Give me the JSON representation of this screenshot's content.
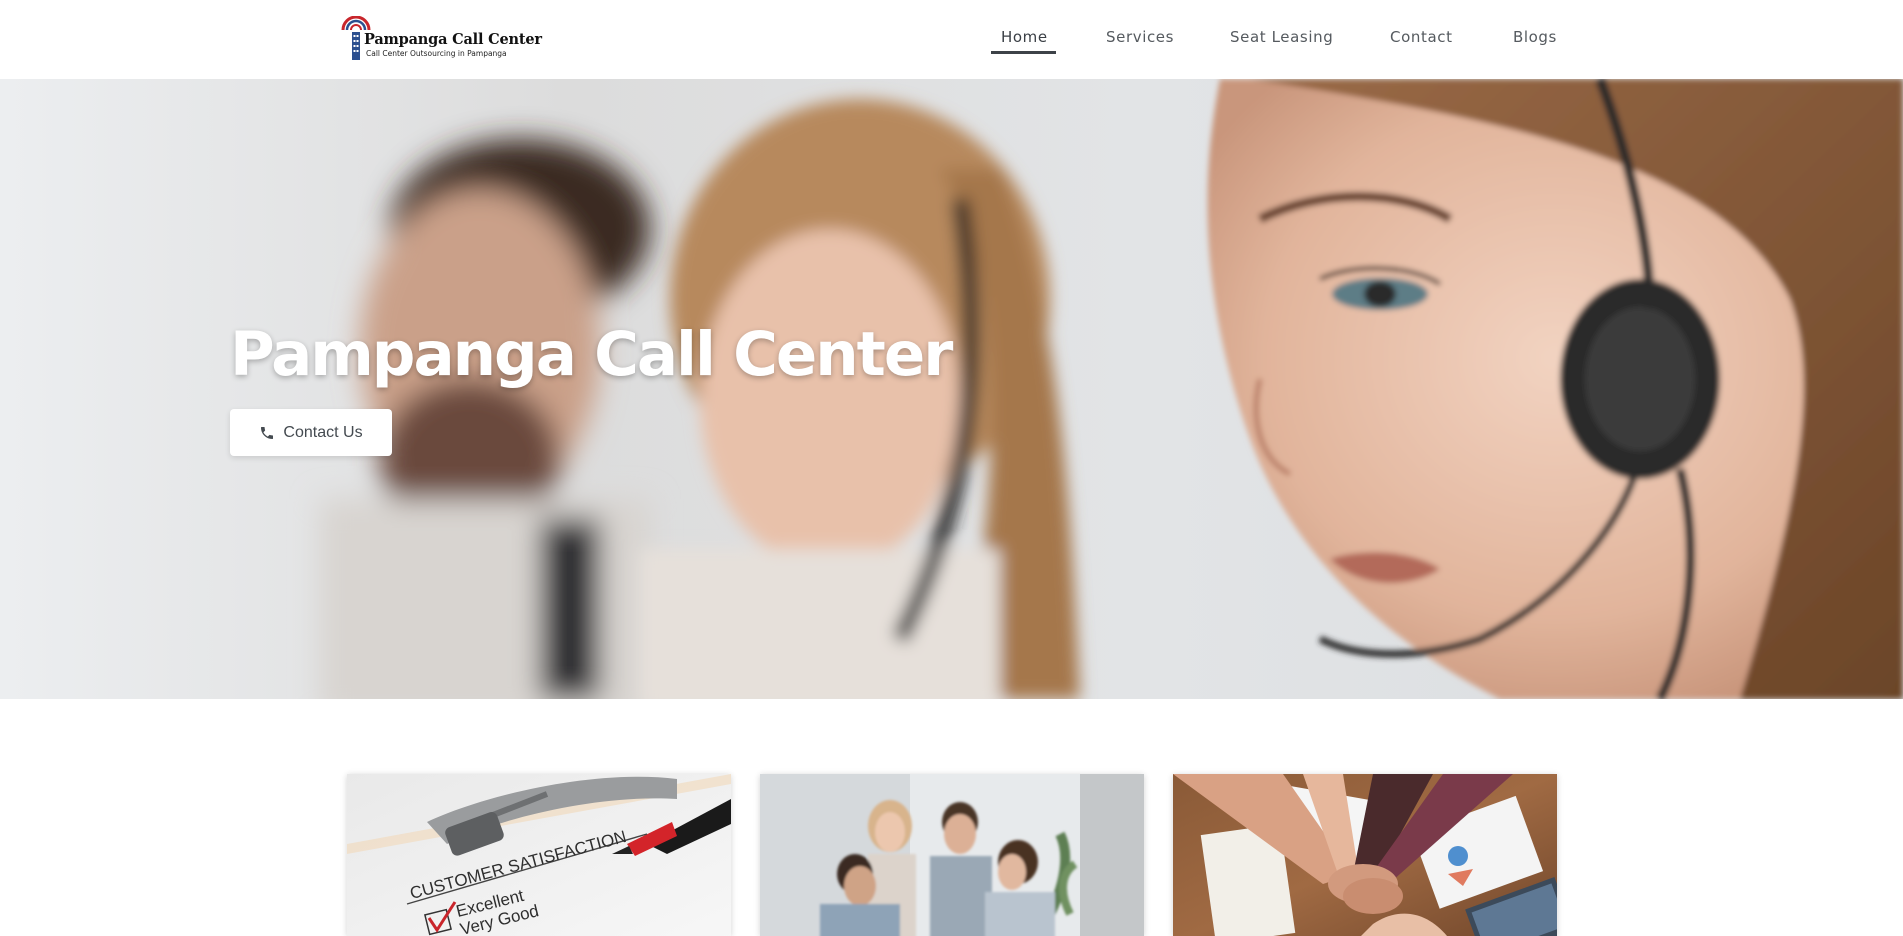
{
  "header": {
    "logo": {
      "title": "Pampanga Call Center",
      "tagline": "Call Center Outsourcing in Pampanga"
    },
    "nav": [
      {
        "label": "Home",
        "active": true
      },
      {
        "label": "Services",
        "active": false
      },
      {
        "label": "Seat Leasing",
        "active": false
      },
      {
        "label": "Contact",
        "active": false
      },
      {
        "label": "Blogs",
        "active": false
      }
    ]
  },
  "hero": {
    "title": "Pampanga Call Center",
    "cta_label": "Contact Us",
    "cta_icon": "phone-icon"
  },
  "cards": [
    {
      "image": "customer-satisfaction-survey-image",
      "image_text": {
        "heading": "CUSTOMER SATISFACTION",
        "option1": "Excellent",
        "option2": "Very Good"
      }
    },
    {
      "image": "team-meeting-image"
    },
    {
      "image": "team-hands-stack-image"
    }
  ],
  "colors": {
    "nav_text": "#555a5f",
    "nav_active_underline": "#3d4248",
    "hero_title": "#ffffff",
    "cta_background": "#ffffff",
    "cta_text": "#444a50",
    "logo_red": "#c8262c",
    "logo_blue": "#2b4f8f"
  }
}
